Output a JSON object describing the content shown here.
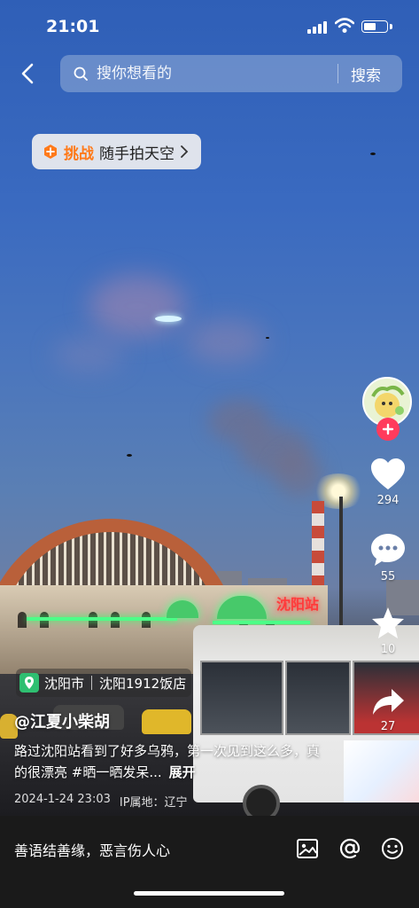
{
  "status_bar": {
    "time": "21:01",
    "battery_level": 0.55
  },
  "search": {
    "placeholder": "搜你想看的",
    "button_label": "搜索"
  },
  "challenge": {
    "tag": "挑战",
    "title": "随手拍天空"
  },
  "stats": {
    "likes": "294",
    "comments": "55",
    "favorites": "10",
    "shares": "27"
  },
  "location": {
    "city": "沈阳市",
    "place": "沈阳1912饭店"
  },
  "post": {
    "author": "@江夏小柴胡",
    "caption": "路过沈阳站看到了好多乌鸦，第一次见到这么多，真的很漂亮 #晒一晒发呆...",
    "expand_label": "展开",
    "datetime": "2024-1-24 23:03",
    "ip_location": "IP属地：辽宁"
  },
  "scene_text": {
    "neon_sign": "沈阳站"
  },
  "comment_bar": {
    "placeholder": "善语结善缘，恶言伤人心"
  },
  "colors": {
    "accent": "#ff7a1a",
    "follow": "#ff3b5c",
    "map_pin": "#2fbf71"
  }
}
